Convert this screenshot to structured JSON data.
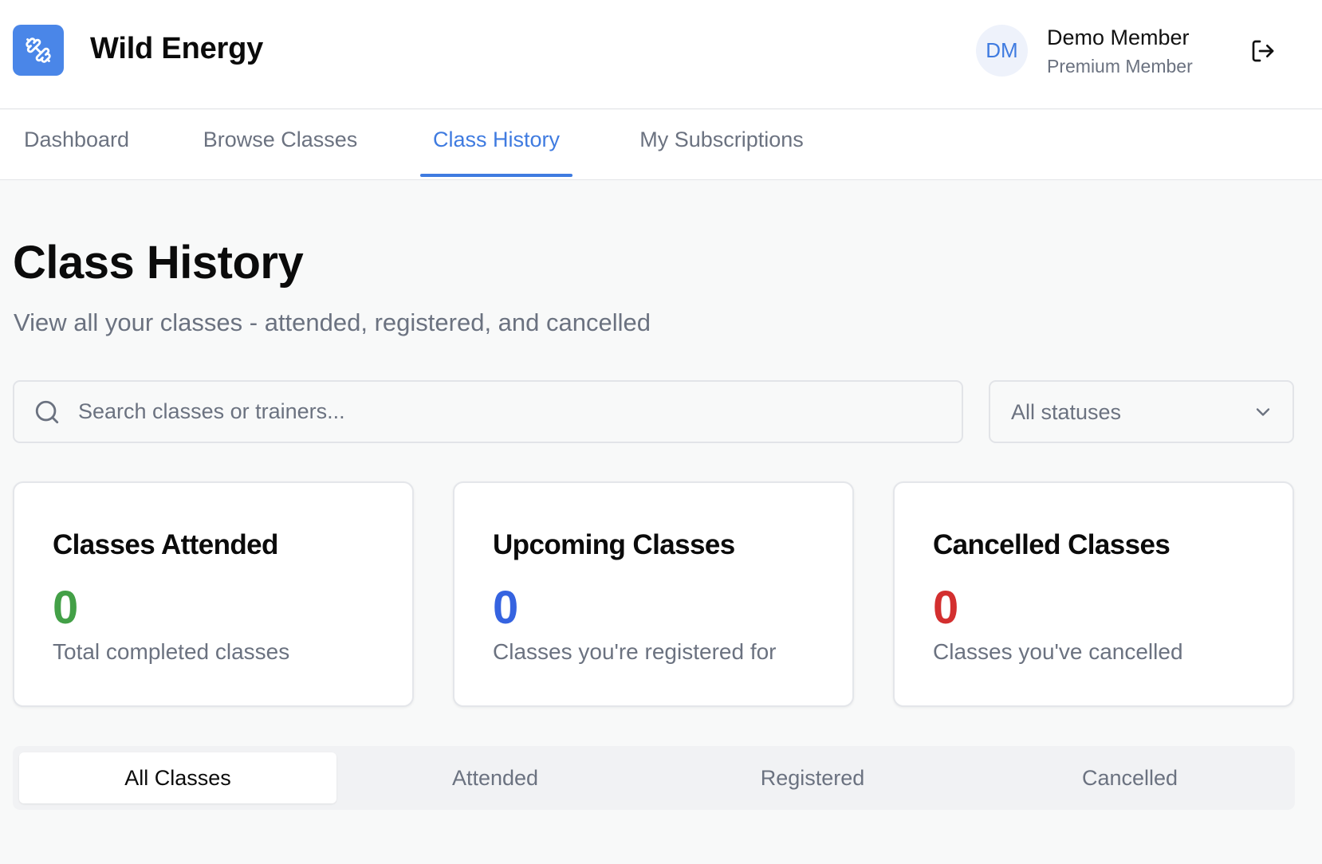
{
  "app": {
    "title": "Wild Energy",
    "logo_icon": "dumbbell-icon",
    "accent_color": "#4a86e8"
  },
  "user": {
    "initials": "DM",
    "name": "Demo Member",
    "tier": "Premium Member",
    "logout_icon": "logout-icon"
  },
  "nav": {
    "tabs": [
      {
        "label": "Dashboard",
        "active": false
      },
      {
        "label": "Browse Classes",
        "active": false
      },
      {
        "label": "Class History",
        "active": true
      },
      {
        "label": "My Subscriptions",
        "active": false
      }
    ]
  },
  "page": {
    "title": "Class History",
    "subtitle": "View all your classes - attended, registered, and cancelled"
  },
  "search": {
    "placeholder": "Search classes or trainers...",
    "value": "",
    "icon": "search-icon"
  },
  "status_filter": {
    "selected": "All statuses",
    "icon": "chevron-down-icon"
  },
  "stats": [
    {
      "title": "Classes Attended",
      "value": "0",
      "description": "Total completed classes",
      "color": "#43a047"
    },
    {
      "title": "Upcoming Classes",
      "value": "0",
      "description": "Classes you're registered for",
      "color": "#3563e0"
    },
    {
      "title": "Cancelled Classes",
      "value": "0",
      "description": "Classes you've cancelled",
      "color": "#d32f2f"
    }
  ],
  "filter_tabs": [
    {
      "label": "All Classes",
      "active": true
    },
    {
      "label": "Attended",
      "active": false
    },
    {
      "label": "Registered",
      "active": false
    },
    {
      "label": "Cancelled",
      "active": false
    }
  ]
}
